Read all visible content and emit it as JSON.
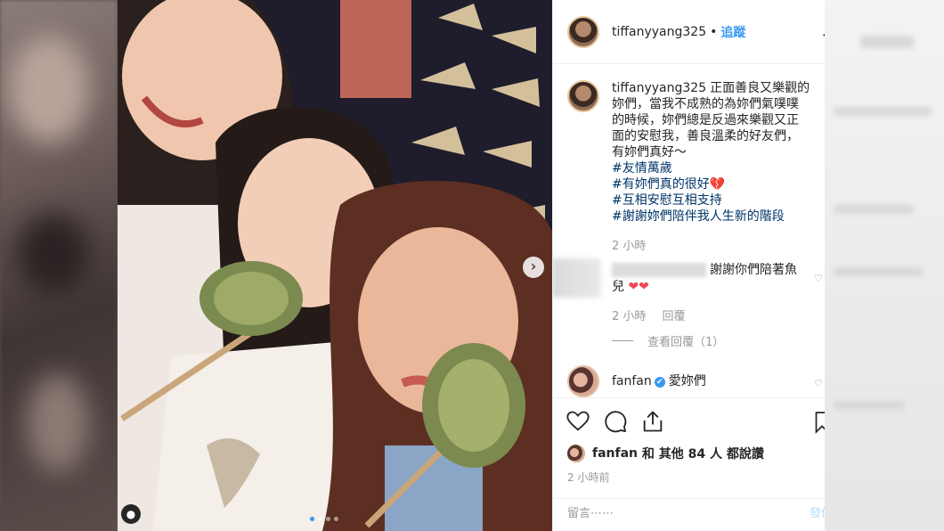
{
  "post": {
    "username": "tiffanyyang325",
    "separator": "•",
    "follow_label": "追蹤",
    "more_label": "·",
    "caption": {
      "username": "tiffanyyang325",
      "text": "正面善良又樂觀的妳們，當我不成熟的為妳們氣噗噗的時候，妳們總是反過來樂觀又正面的安慰我，善良溫柔的好友們，有妳們真好～",
      "hashtags": [
        "#友情萬歲",
        "#有妳們真的很好",
        "#互相安慰互相支持",
        "#謝謝妳們陪伴我人生新的階段"
      ],
      "heart": "💔",
      "time": "2 小時"
    },
    "comments": [
      {
        "text": "謝謝你們陪著魚兒",
        "hearts": "❤❤",
        "time": "2 小時",
        "reply_label": "回覆",
        "view_replies": "查看回覆（1）",
        "like_icon": "heart-outline-icon"
      },
      {
        "username": "fanfan",
        "verified": "✔",
        "text": "愛妳們",
        "like_icon": "heart-outline-icon"
      }
    ],
    "likes": {
      "first_user": "fanfan",
      "rest": "和 其他 84 人 都說讚"
    },
    "posted_ago": "2 小時前",
    "comment_placeholder": "留言⋯⋯",
    "post_button": "發佈",
    "carousel": {
      "slides": 4,
      "active_index": 0,
      "next_arrow": "›"
    },
    "tag_icon": "user-tag-icon"
  },
  "colors": {
    "link_blue": "#3897f0",
    "hashtag": "#003569",
    "muted": "#999999",
    "red_heart": "#ed4956"
  }
}
